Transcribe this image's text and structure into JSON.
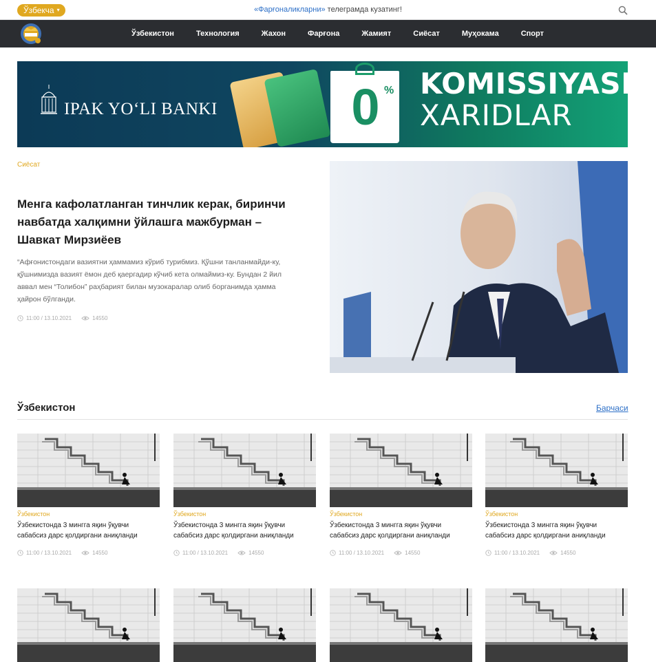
{
  "topbar": {
    "language": "Ўзбекча",
    "promo_link": "«Фарғоналикларни»",
    "promo_text": " телеграмда кузатинг!"
  },
  "nav": {
    "items": [
      "Ўзбекистон",
      "Технология",
      "Жахон",
      "Фарғона",
      "Жамият",
      "Сиёсат",
      "Муҳокама",
      "Спорт"
    ]
  },
  "banner": {
    "bank_name": "IPAK YO‘LI BANKI",
    "headline1": "KOMISSIYASIZ",
    "headline2": "XARIDLAR",
    "big_number": "0",
    "percent": "%"
  },
  "featured": {
    "category": "Сиёсат",
    "title": "Менга кафолатланган тинчлик керак, биринчи навбатда халқимни ўйлашга мажбурман – Шавкат Мирзиёев",
    "excerpt": "“Афғонистондаги вазиятни ҳаммамиз кўриб турибмиз. Қўшни танланмайди-ку, қўшнимизда вазият ёмон деб қаергадир кўчиб кета олмаймиз-ку. Бундан 2 йил аввал мен “Толибон” раҳбарият билан музокаралар олиб борганимда ҳамма ҳайрон бўлганди.",
    "time": "11:00 / 13.10.2021",
    "views": "14550"
  },
  "section": {
    "title": "Ўзбекистон",
    "see_all": "Барчаси",
    "cards": [
      {
        "category": "Ўзбекистон",
        "title": "Ўзбекистонда 3 мингга яқин ўқувчи сабабсиз дарс қолдиргани аниқланди",
        "time": "11:00 / 13.10.2021",
        "views": "14550"
      },
      {
        "category": "Ўзбекистон",
        "title": "Ўзбекистонда 3 мингга яқин ўқувчи сабабсиз дарс қолдиргани аниқланди",
        "time": "11:00 / 13.10.2021",
        "views": "14550"
      },
      {
        "category": "Ўзбекистон",
        "title": "Ўзбекистонда 3 мингга яқин ўқувчи сабабсиз дарс қолдиргани аниқланди",
        "time": "11:00 / 13.10.2021",
        "views": "14550"
      },
      {
        "category": "Ўзбекистон",
        "title": "Ўзбекистонда 3 мингга яқин ўқувчи сабабсиз дарс қолдиргани аниқланди",
        "time": "11:00 / 13.10.2021",
        "views": "14550"
      }
    ]
  },
  "colors": {
    "accent": "#e0a820",
    "nav_bg": "#2b2d31",
    "link": "#2c6fc7"
  }
}
